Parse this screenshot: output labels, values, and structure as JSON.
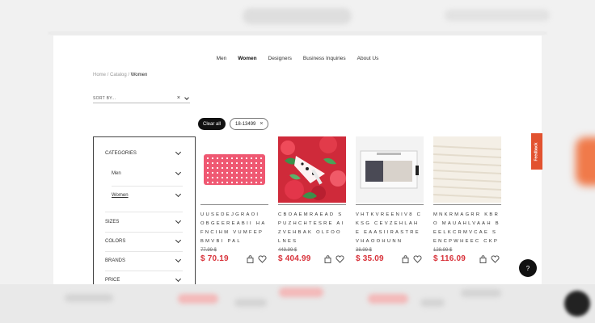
{
  "nav": [
    "Men",
    "Women",
    "Designers",
    "Business Inquiries",
    "About Us"
  ],
  "nav_active": "Women",
  "breadcrumb": {
    "home": "Home",
    "catalog": "Catalog",
    "current": "Women",
    "sep": " / "
  },
  "sort": {
    "label": "SORT BY..."
  },
  "filters": {
    "clear_all": "Clear all",
    "chips": [
      "18-13499"
    ]
  },
  "sidebar": {
    "categories": "CATEGORIES",
    "men": "Men",
    "women": "Women",
    "sizes": "SIZES",
    "colors": "COLORS",
    "brands": "BRANDS",
    "price": "PRICE"
  },
  "products": [
    {
      "name": "UUSEDEJGRAOI OBGEEREABII HAFNCIHM VUMFEPBMVBI PAL",
      "old_price": "77.99 $",
      "price": "$ 70.19",
      "image": "pink-polka-dot-bag"
    },
    {
      "name": "CBOAEMRAEAD SPUZHCHTESRE AIZVEHBAK OLFOOLNES",
      "old_price": "449.99 $",
      "price": "$ 404.99",
      "image": "floral-heels"
    },
    {
      "name": "VHTKVREENIV8 CKSG CEVZEHLAHE EAASIIRASTRE VHAOOHUNN",
      "old_price": "38.99 $",
      "price": "$ 35.09",
      "image": "boxed-accessory"
    },
    {
      "name": "MNKRMAGRR KBRO MAUAHLVAAH BEELKCRMVCAE SENCPWHEEC CKP",
      "old_price": "128.99 $",
      "price": "$ 116.09",
      "image": "cream-knit"
    }
  ],
  "feedback": "Feedback",
  "help": "?",
  "icons": {
    "bag": "shopping-bag-icon",
    "heart": "heart-icon",
    "close": "close-icon",
    "chevron": "chevron-down-icon"
  },
  "colors": {
    "price": "#d8323a",
    "accent": "#e2522f",
    "dark": "#111111"
  }
}
